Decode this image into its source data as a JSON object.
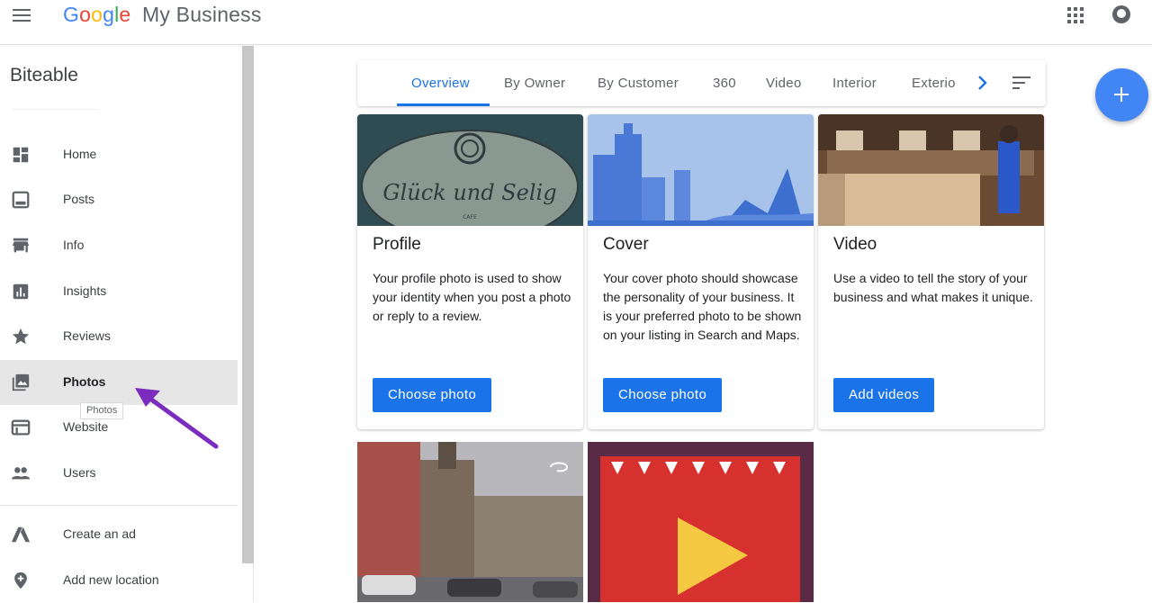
{
  "header": {
    "logo_letters": [
      "G",
      "o",
      "o",
      "g",
      "l",
      "e"
    ],
    "product": "My Business"
  },
  "sidebar": {
    "business_name": "Biteable",
    "items": [
      {
        "label": "Home",
        "icon": "dashboard-icon"
      },
      {
        "label": "Posts",
        "icon": "posts-icon"
      },
      {
        "label": "Info",
        "icon": "storefront-icon"
      },
      {
        "label": "Insights",
        "icon": "bar-chart-icon"
      },
      {
        "label": "Reviews",
        "icon": "star-icon"
      },
      {
        "label": "Photos",
        "icon": "photo-icon",
        "active": true
      },
      {
        "label": "Website",
        "icon": "web-icon"
      },
      {
        "label": "Users",
        "icon": "people-icon"
      },
      {
        "label": "Create an ad",
        "icon": "google-ads-icon"
      },
      {
        "label": "Add new location",
        "icon": "location-pin-icon"
      }
    ],
    "tooltip": "Photos"
  },
  "tabs": [
    "Overview",
    "By Owner",
    "By Customer",
    "360",
    "Video",
    "Interior",
    "Exterio"
  ],
  "active_tab": "Overview",
  "cards": [
    {
      "title": "Profile",
      "text": "Your profile photo is used to show your identity when you post a photo or reply to a review.",
      "button": "Choose photo",
      "logo_text": "Glück und Selig",
      "logo_subtext": "CAFE"
    },
    {
      "title": "Cover",
      "text": "Your cover photo should showcase the personality of your business. It is your preferred photo to be shown on your listing in Search and Maps.",
      "button": "Choose photo"
    },
    {
      "title": "Video",
      "text": "Use a video to tell the story of your business and what makes it unique.",
      "button": "Add videos"
    }
  ],
  "colors": {
    "accent": "#1a73e8",
    "fab": "#4285f4",
    "annotation_arrow": "#7b2cbf"
  }
}
